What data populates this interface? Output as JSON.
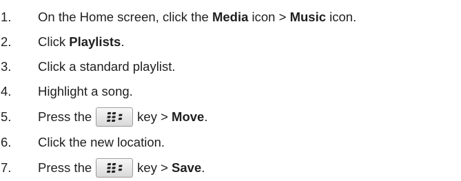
{
  "steps": [
    {
      "num": "1.",
      "segments": [
        {
          "text": "On the Home screen, click the ",
          "bold": false
        },
        {
          "text": "Media",
          "bold": true
        },
        {
          "text": " icon > ",
          "bold": false
        },
        {
          "text": "Music",
          "bold": true
        },
        {
          "text": " icon.",
          "bold": false
        }
      ]
    },
    {
      "num": "2.",
      "segments": [
        {
          "text": "Click ",
          "bold": false
        },
        {
          "text": "Playlists",
          "bold": true
        },
        {
          "text": ".",
          "bold": false
        }
      ]
    },
    {
      "num": "3.",
      "segments": [
        {
          "text": "Click a standard playlist.",
          "bold": false
        }
      ]
    },
    {
      "num": "4.",
      "segments": [
        {
          "text": "Highlight a song.",
          "bold": false
        }
      ]
    },
    {
      "num": "5.",
      "segments": [
        {
          "text": "Press the",
          "bold": false
        },
        {
          "key": "menu-key-icon"
        },
        {
          "text": "key > ",
          "bold": false
        },
        {
          "text": "Move",
          "bold": true
        },
        {
          "text": ".",
          "bold": false
        }
      ]
    },
    {
      "num": "6.",
      "segments": [
        {
          "text": "Click the new location.",
          "bold": false
        }
      ]
    },
    {
      "num": "7.",
      "segments": [
        {
          "text": "Press the",
          "bold": false
        },
        {
          "key": "menu-key-icon"
        },
        {
          "text": "key > ",
          "bold": false
        },
        {
          "text": "Save",
          "bold": true
        },
        {
          "text": ".",
          "bold": false
        }
      ]
    }
  ],
  "colors": {
    "text": "#1f1f1f",
    "key_border": "#9a9a9a"
  }
}
